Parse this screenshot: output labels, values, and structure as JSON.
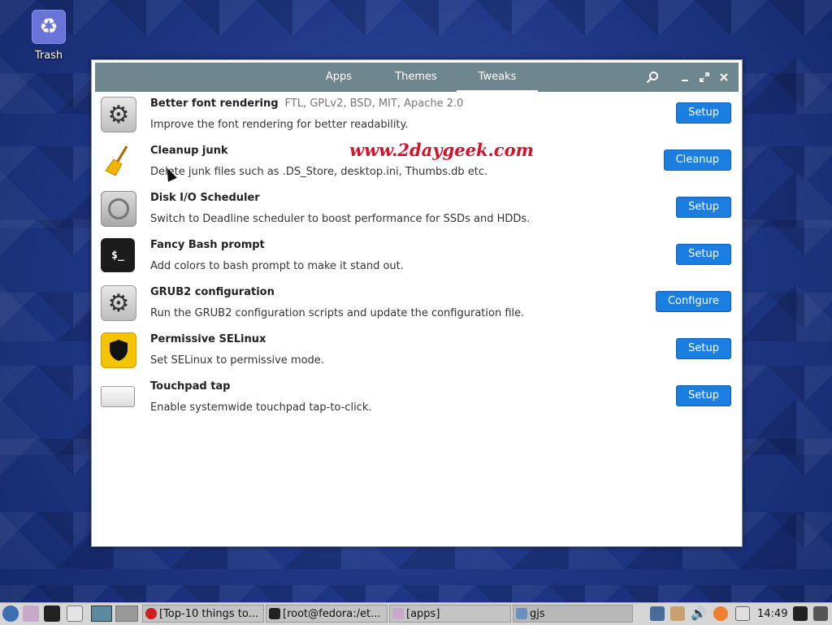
{
  "desktop": {
    "trash_label": "Trash"
  },
  "header": {
    "tabs": [
      {
        "label": "Apps",
        "active": false
      },
      {
        "label": "Themes",
        "active": false
      },
      {
        "label": "Tweaks",
        "active": true
      }
    ],
    "icons": [
      "search-icon",
      "minimize-icon",
      "maximize-icon",
      "close-icon"
    ]
  },
  "tweaks": [
    {
      "title": "Better font rendering",
      "license": "FTL, GPLv2, BSD, MIT, Apache 2.0",
      "desc": "Improve the font rendering for better readability.",
      "button": "Setup",
      "icon": "gears-icon"
    },
    {
      "title": "Cleanup junk",
      "license": "",
      "desc": "Delete junk files such as .DS_Store, desktop.ini, Thumbs.db etc.",
      "button": "Cleanup",
      "icon": "broom-icon"
    },
    {
      "title": "Disk I/O Scheduler",
      "license": "",
      "desc": "Switch to Deadline scheduler to boost performance for SSDs and HDDs.",
      "button": "Setup",
      "icon": "disk-icon"
    },
    {
      "title": "Fancy Bash prompt",
      "license": "",
      "desc": "Add colors to bash prompt to make it stand out.",
      "button": "Setup",
      "icon": "terminal-icon"
    },
    {
      "title": "GRUB2 configuration",
      "license": "",
      "desc": "Run the GRUB2 configuration scripts and update the configuration file.",
      "button": "Configure",
      "icon": "gears-icon"
    },
    {
      "title": "Permissive SELinux",
      "license": "",
      "desc": "Set SELinux to permissive mode.",
      "button": "Setup",
      "icon": "shield-icon"
    },
    {
      "title": "Touchpad tap",
      "license": "",
      "desc": "Enable systemwide touchpad tap-to-click.",
      "button": "Setup",
      "icon": "touchpad-icon"
    }
  ],
  "watermark": "www.2daygeek.com",
  "terminal_icon_text": "$_",
  "taskbar": {
    "tasks": [
      {
        "label": "[Top-10 things to...",
        "color": "#cc1f1f"
      },
      {
        "label": "[root@fedora:/et...",
        "color": "#222222"
      },
      {
        "label": "[apps]",
        "color": "#c9a9c9"
      },
      {
        "label": "gjs",
        "color": "#6c8fc0"
      }
    ],
    "clock": "14:49"
  }
}
